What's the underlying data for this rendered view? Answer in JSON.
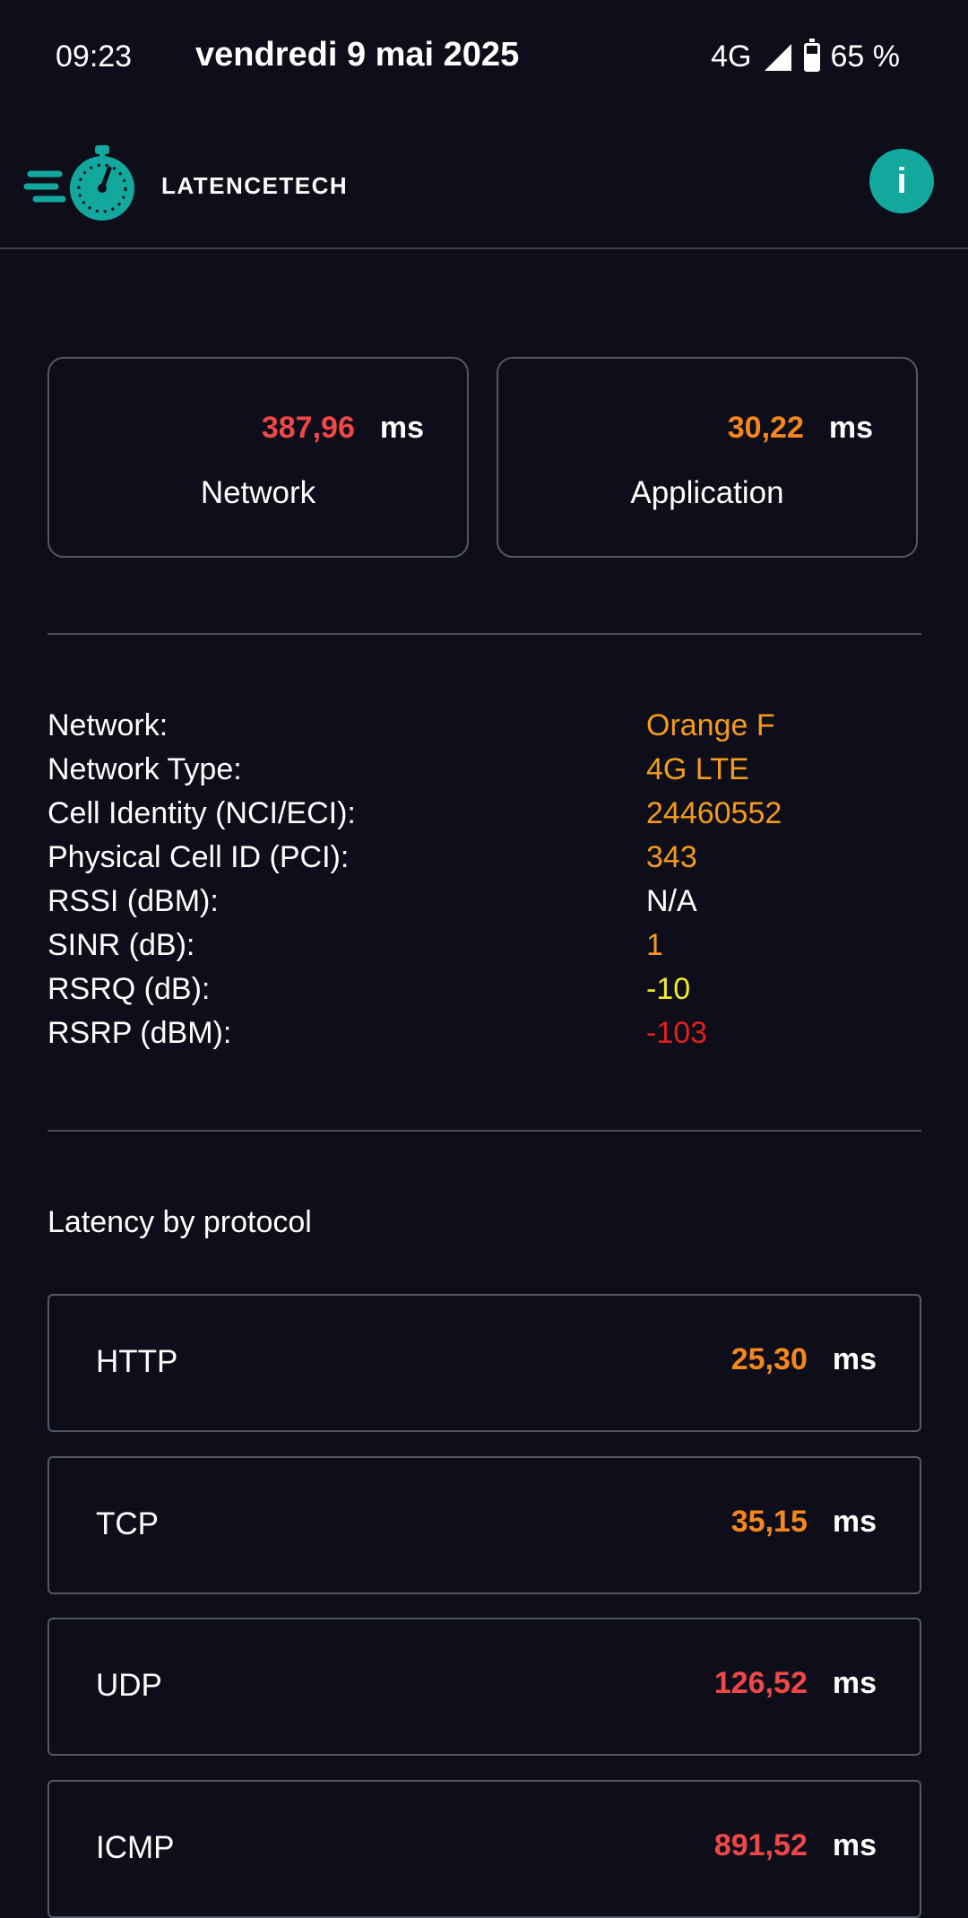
{
  "status_bar": {
    "time": "09:23",
    "date": "vendredi 9 mai 2025",
    "network": "4G",
    "battery": "65 %",
    "battery_level": 0.65
  },
  "header": {
    "app_name": "LATENCETECH",
    "info_label": "i",
    "brand_color": "#13a89e"
  },
  "summary": [
    {
      "value": "387,96",
      "unit": "ms",
      "label": "Network",
      "color": "#f04848"
    },
    {
      "value": "30,22",
      "unit": "ms",
      "label": "Application",
      "color": "#f5871c"
    }
  ],
  "network_info": [
    {
      "key": "Network:",
      "value": "Orange F",
      "color": "#f59a1c"
    },
    {
      "key": "Network Type:",
      "value": "4G LTE",
      "color": "#f59a1c"
    },
    {
      "key": "Cell Identity (NCI/ECI):",
      "value": "24460552",
      "color": "#f59a1c"
    },
    {
      "key": "Physical Cell ID (PCI):",
      "value": "343",
      "color": "#f59a1c"
    },
    {
      "key": "RSSI (dBM):",
      "value": "N/A",
      "color": "#ffffff"
    },
    {
      "key": "SINR (dB):",
      "value": "1",
      "color": "#f59a1c"
    },
    {
      "key": "RSRQ (dB):",
      "value": "-10",
      "color": "#f2e82a"
    },
    {
      "key": "RSRP (dBM):",
      "value": "-103",
      "color": "#e01e1e"
    }
  ],
  "protocols": {
    "title": "Latency by protocol",
    "items": [
      {
        "name": "HTTP",
        "value": "25,30",
        "unit": "ms",
        "color": "#f5871c"
      },
      {
        "name": "TCP",
        "value": "35,15",
        "unit": "ms",
        "color": "#f5871c"
      },
      {
        "name": "UDP",
        "value": "126,52",
        "unit": "ms",
        "color": "#f04848"
      },
      {
        "name": "ICMP",
        "value": "891,52",
        "unit": "ms",
        "color": "#f04848"
      }
    ]
  }
}
